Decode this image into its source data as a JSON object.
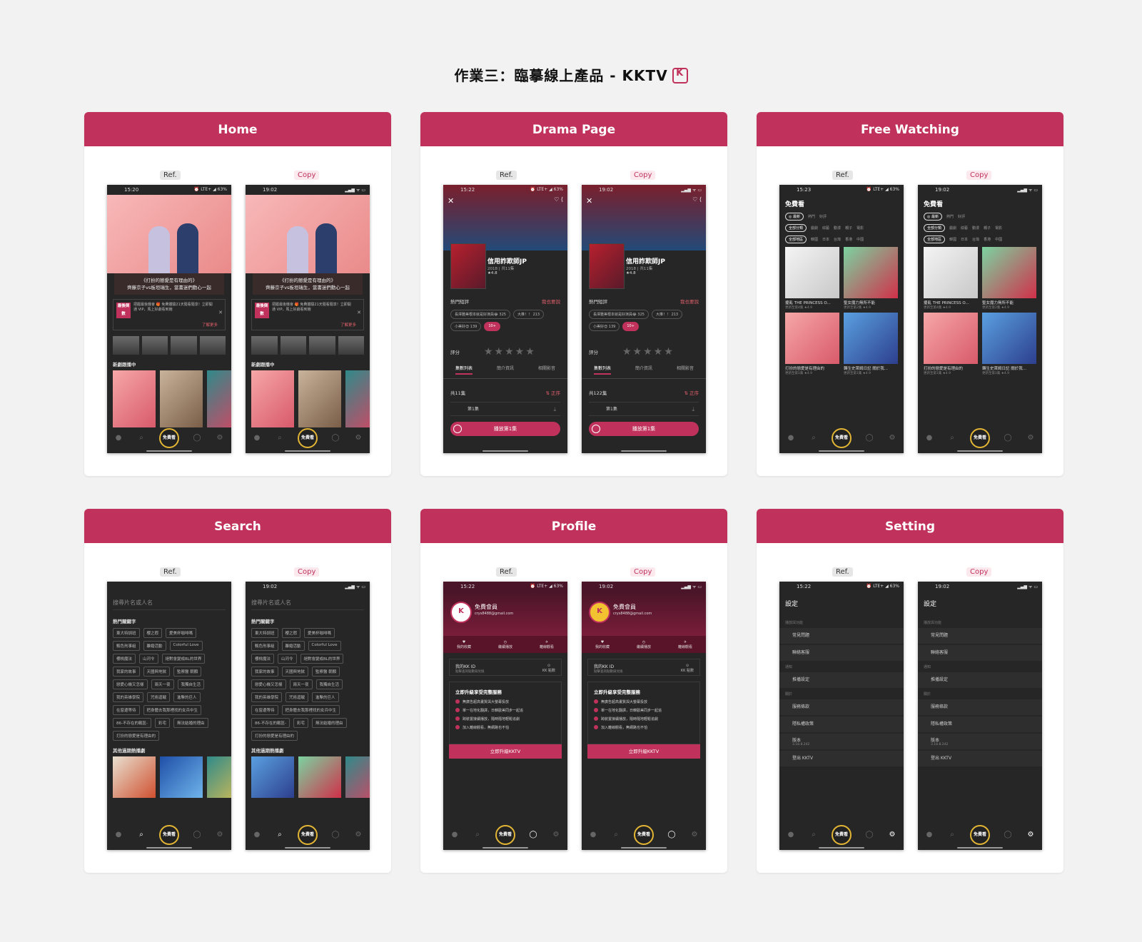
{
  "header": {
    "title": "作業三：臨摹線上產品 - KKTV"
  },
  "labels": {
    "ref": "Ref.",
    "copy": "Copy"
  },
  "sections": {
    "home": "Home",
    "drama": "Drama Page",
    "free": "Free Watching",
    "search": "Search",
    "profile": "Profile",
    "setting": "Setting"
  },
  "status": {
    "ref_time_home": "15:20",
    "copy_time": "19:02",
    "ref_time_drama": "15:22",
    "ref_time_free": "15:23",
    "ref_time_profile": "15:22",
    "ref_time_setting": "15:22",
    "ref_right": "⏰ LTE+ ◢ 63%",
    "copy_right": "▂▄▆ ᯤ ▭"
  },
  "nav": {
    "free": "免費看"
  },
  "home": {
    "caption_line1": "《打扮的戀愛是有理由的》",
    "caption_line2": "齊藤京子vs板垣瑞生，當書迷們動心一起",
    "promo_badge": "最後倒數",
    "promo_text": "把握最後機會 🎁 免費體驗21天隨看隨享！立即開通 VIP，馬上好劇看到飽",
    "promo_more": "了解更多",
    "section": "新劇跟播中"
  },
  "drama": {
    "title": "信用詐欺師JP",
    "meta": "2018 | 共11集",
    "meta_copy": "2018 | 共11集",
    "rate": "★4.8",
    "reviews": "熱門短評",
    "reviews_link": "我也要說",
    "chips": [
      "長澤雅美根本就是好演員😂 325",
      "大推！！ 213",
      "小美好😍 139",
      "10+"
    ],
    "rating": "評分",
    "stars": "★★★★★",
    "tabs": [
      "集數列表",
      "簡介資訊",
      "相關影音"
    ],
    "ep_total_ref": "共11集",
    "ep_total_copy": "共122集",
    "ep_order": "⇅ 正序",
    "ep_item": "第1集",
    "play": "播放第1集"
  },
  "free": {
    "title": "免費看",
    "sort": [
      "◎ 最新",
      "熱門",
      "好評"
    ],
    "filter1": [
      "全部分類",
      "戲劇",
      "綜藝",
      "動漫",
      "親子",
      "電影"
    ],
    "filter2": [
      "全部地區",
      "韓國",
      "日本",
      "台灣",
      "香港",
      "中國"
    ],
    "items": [
      {
        "cap": "擾亂 THE PRINCESS O...",
        "sub": "更新至第4集 ★4.9"
      },
      {
        "cap": "聖女魔力無所不能",
        "sub": "更新至第2集 ★4.9"
      },
      {
        "cap": "打扮的戀愛是有理由的",
        "sub": "更新至第1集 ★4.9"
      },
      {
        "cap": "轉生史萊姆日記 關於我...",
        "sub": "更新至第1集 ★4.9"
      }
    ]
  },
  "search": {
    "placeholder": "搜尋片名或人名",
    "hot": "熱門關鍵字",
    "keywords": [
      "東大特訓班",
      "櫻之瑕",
      "愛美杯咖啡嗎",
      "甄色刑事組",
      "離婚活動",
      "Colorful Love",
      "櫻桃魔法",
      "山河令",
      "絕對會變成BL的世界",
      "我家的故事",
      "天國與地獄",
      "監察醫 朝顏",
      "戀愛心機又怎樣",
      "兩天一夜",
      "我獨自生活",
      "我的英雄學院",
      "咒術迴戰",
      "進擊的巨人",
      "在窗邊等待",
      "把身體去我那裡找的女兵中生",
      "86-不存在的戰區-",
      "彩宅",
      "無法結婚的理由",
      "打扮的戀愛是有理由的"
    ],
    "coming": "其他過期熱播劇"
  },
  "profile": {
    "name": "免費會員",
    "email": "crys8488@gmail.com",
    "actions": [
      "我的收藏",
      "繼續播放",
      "離線觀看"
    ],
    "kkid": "我的KK ID",
    "kkid_sub": "點擊查詢點數與兌換",
    "points": "KK 點數",
    "upgrade_title": "立即升級享受完整服務",
    "benefits": [
      "無廣告超高畫質與大螢幕投放",
      "單一在地化翻譯，日韓歐美同步一起追",
      "跨裝置接續播放，隨時隨地輕鬆追劇",
      "加入離線觀看，無網路也不怕"
    ],
    "upgrade_btn": "立即升級KKTV"
  },
  "setting": {
    "title": "設定",
    "group1": "播放與功能",
    "item1": "常見問題",
    "item2": "聯絡客服",
    "group2": "通知",
    "item3": "推播設定",
    "group3": "關於",
    "item4": "服務條款",
    "item5": "隱私權政策",
    "item6": "版本",
    "version": "3.18.8.242",
    "item7": "登出 KKTV"
  }
}
